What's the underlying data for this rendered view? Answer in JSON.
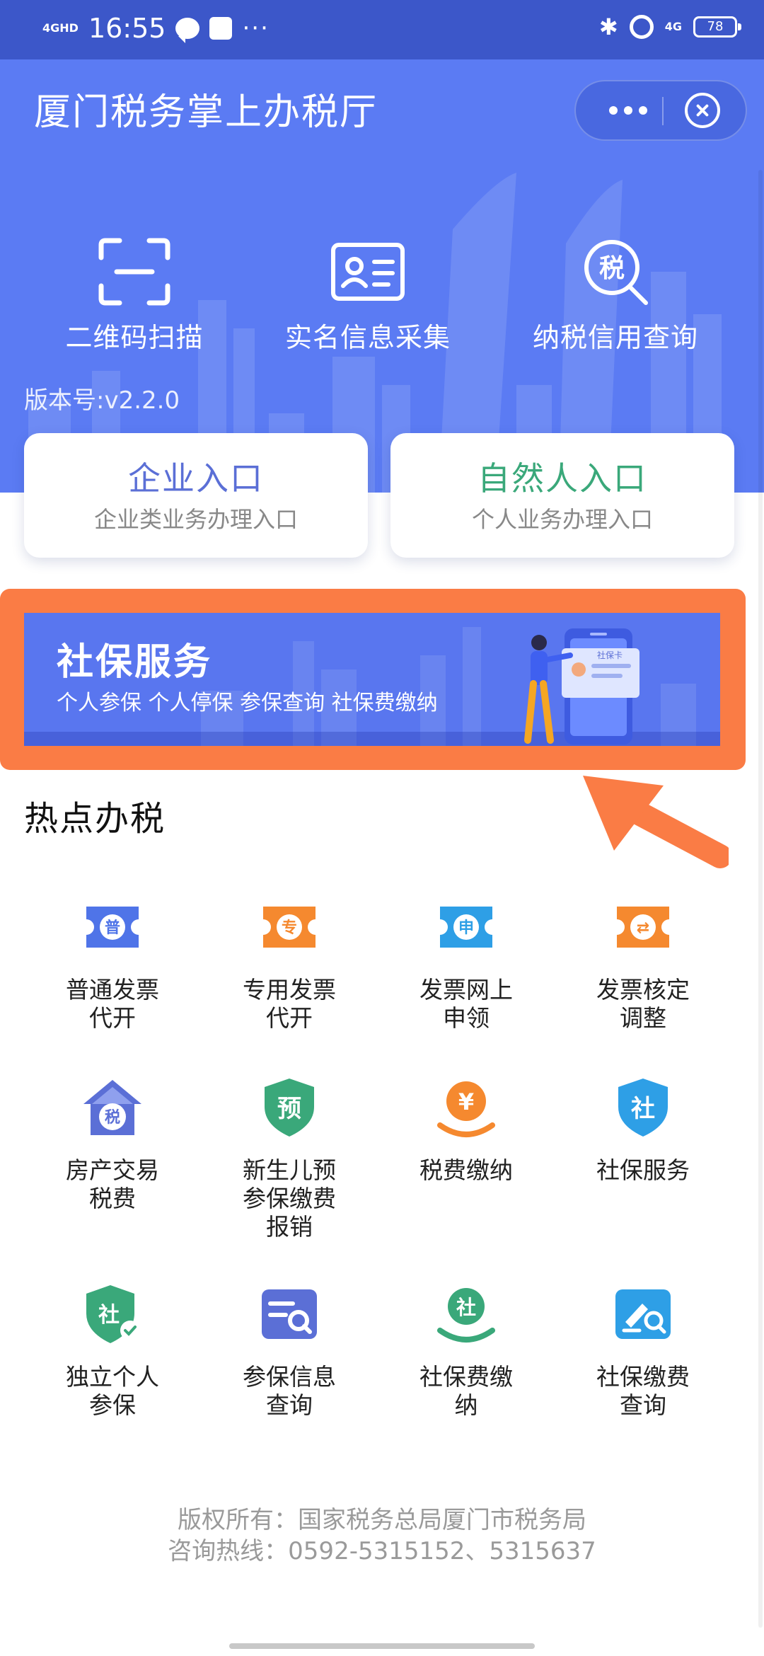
{
  "status_bar": {
    "network": "4GHD",
    "time": "16:55",
    "more": "···",
    "bluetooth": "✱",
    "network_right": "4G",
    "battery": "78"
  },
  "header": {
    "title": "厦门税务掌上办税厅",
    "tools": [
      {
        "label": "二维码扫描",
        "icon": "scan-icon"
      },
      {
        "label": "实名信息采集",
        "icon": "id-card-icon"
      },
      {
        "label": "纳税信用查询",
        "icon": "tax-search-icon",
        "glyph": "税"
      }
    ],
    "version": "版本号:v2.2.0"
  },
  "entries": [
    {
      "title": "企业入口",
      "subtitle": "企业类业务办理入口",
      "color": "#5b6fd6"
    },
    {
      "title": "自然人入口",
      "subtitle": "个人业务办理入口",
      "color": "#3aa87a"
    }
  ],
  "banner": {
    "title": "社保服务",
    "subtitle": "个人参保  个人停保  参保查询  社保费缴纳",
    "card_text": "社保卡"
  },
  "hot": {
    "title": "热点办税",
    "items": [
      {
        "label": "普通发票\n代开",
        "icon": "invoice-icon",
        "glyph": "普",
        "color": "#4f74e8"
      },
      {
        "label": "专用发票\n代开",
        "icon": "invoice-icon",
        "glyph": "专",
        "color": "#f5892f"
      },
      {
        "label": "发票网上\n申领",
        "icon": "invoice-icon",
        "glyph": "申",
        "color": "#2e9fe6"
      },
      {
        "label": "发票核定\n调整",
        "icon": "invoice-adjust-icon",
        "glyph": "⇄",
        "color": "#f5892f"
      },
      {
        "label": "房产交易\n税费",
        "icon": "house-tax-icon",
        "glyph": "税",
        "color": "#5b6fd6"
      },
      {
        "label": "新生儿预\n参保缴费\n报销",
        "icon": "newborn-shield-icon",
        "glyph": "预",
        "color": "#3aa87a"
      },
      {
        "label": "税费缴纳",
        "icon": "yuan-payment-icon",
        "glyph": "¥",
        "color": "#f5892f"
      },
      {
        "label": "社保服务",
        "icon": "social-shield-icon",
        "glyph": "社",
        "color": "#2e9fe6"
      },
      {
        "label": "独立个人\n参保",
        "icon": "individual-insurance-icon",
        "glyph": "社",
        "color": "#3aa87a"
      },
      {
        "label": "参保信息\n查询",
        "icon": "insurance-search-icon",
        "glyph": "",
        "color": "#5b6fd6"
      },
      {
        "label": "社保费缴\n纳",
        "icon": "social-payment-icon",
        "glyph": "社",
        "color": "#3aa87a"
      },
      {
        "label": "社保缴费\n查询",
        "icon": "payment-search-icon",
        "glyph": "",
        "color": "#2e9fe6"
      }
    ]
  },
  "footer": {
    "copyright": "版权所有：国家税务总局厦门市税务局",
    "hotline": "咨询热线：0592-5315152、5315637"
  }
}
